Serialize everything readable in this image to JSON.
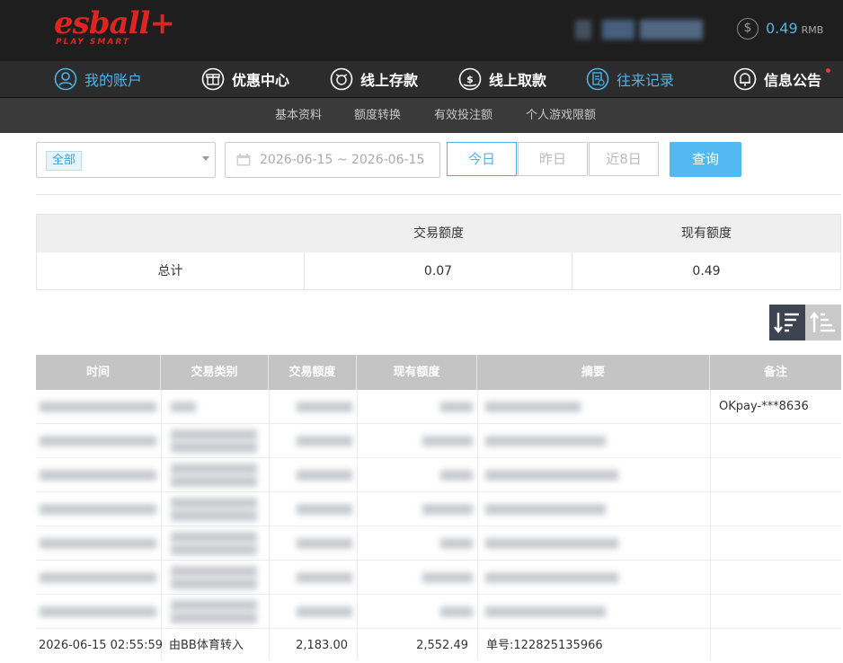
{
  "brand": {
    "logo_text": "esball+",
    "tagline": "PLAY SMART",
    "color": "#e02424"
  },
  "account": {
    "balance": "0.49",
    "currency": "RMB"
  },
  "nav": {
    "items": [
      {
        "label": "我的账户",
        "icon": "user-icon"
      },
      {
        "label": "优惠中心",
        "icon": "gift-icon"
      },
      {
        "label": "线上存款",
        "icon": "deposit-icon"
      },
      {
        "label": "线上取款",
        "icon": "withdraw-icon"
      },
      {
        "label": "往来记录",
        "icon": "record-icon"
      },
      {
        "label": "信息公告",
        "icon": "bell-icon"
      }
    ]
  },
  "subnav": {
    "items": [
      "基本资料",
      "额度转换",
      "有效投注额",
      "个人游戏限额"
    ]
  },
  "filter": {
    "type_selected": "全部",
    "date_range": "2026-06-15 ~ 2026-06-15",
    "today": "今日",
    "yesterday": "昨日",
    "last8": "近8日",
    "query": "查询"
  },
  "summary": {
    "header_amount": "交易额度",
    "header_balance": "现有额度",
    "label": "总计",
    "amount": "0.07",
    "balance": "0.49"
  },
  "table": {
    "headers": [
      "时间",
      "交易类别",
      "交易额度",
      "现有额度",
      "摘要",
      "备注"
    ],
    "first_row_note": "OKpay-***8636",
    "last_row": {
      "time": "2026-06-15 02:55:59",
      "type": "由BB体育转入",
      "amount": "2,183.00",
      "balance": "2,552.49",
      "summary": "单号:122825135966"
    }
  },
  "colors": {
    "accent": "#4fb3e8",
    "topbar": "#1e1e1e",
    "navbar": "#2c2c2c",
    "subnav": "#3a3a3a"
  }
}
